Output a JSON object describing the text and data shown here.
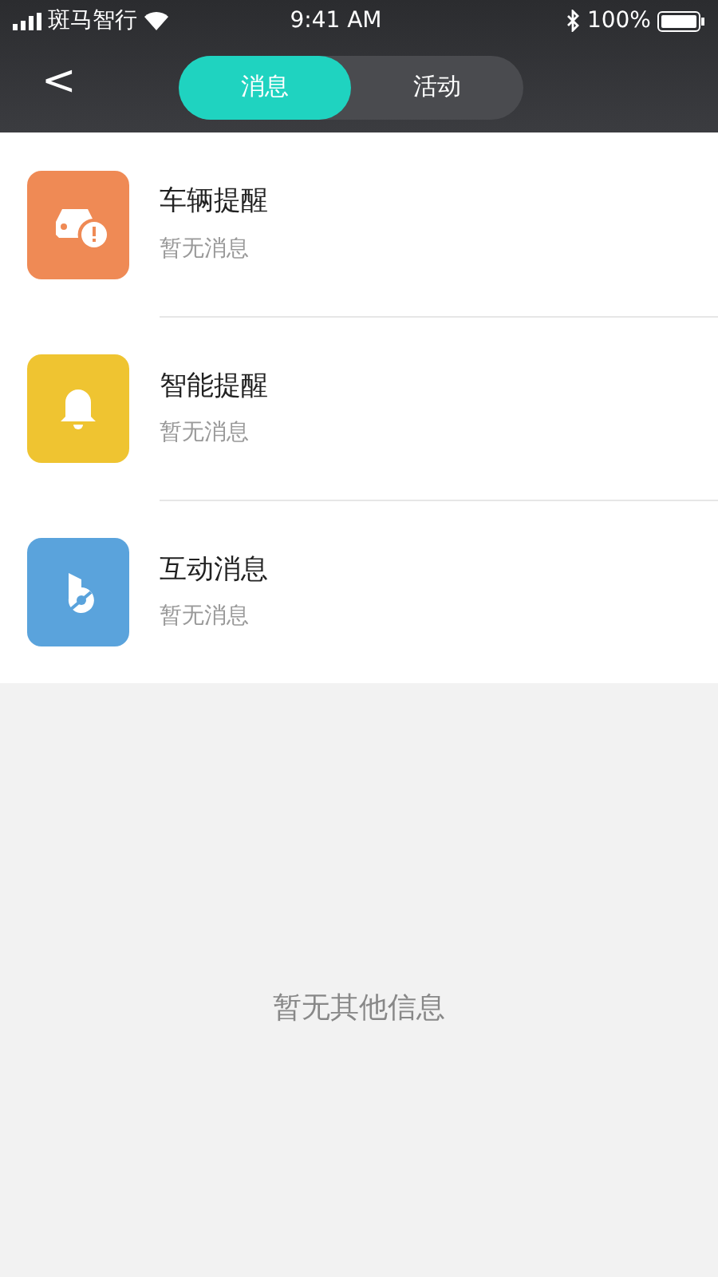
{
  "status_bar": {
    "carrier": "斑马智行",
    "time": "9:41 AM",
    "battery": "100%"
  },
  "nav": {
    "back": "<",
    "tabs": [
      {
        "label": "消息",
        "selected": true
      },
      {
        "label": "活动",
        "selected": false
      }
    ]
  },
  "messages": [
    {
      "kind": "car",
      "color": "#ef8a55",
      "title": "车辆提醒",
      "subtitle": "暂无消息"
    },
    {
      "kind": "bell",
      "color": "#efc431",
      "title": "智能提醒",
      "subtitle": "暂无消息"
    },
    {
      "kind": "logo",
      "color": "#5aa3dc",
      "title": "互动消息",
      "subtitle": "暂无消息"
    }
  ],
  "empty_text": "暂无其他信息"
}
